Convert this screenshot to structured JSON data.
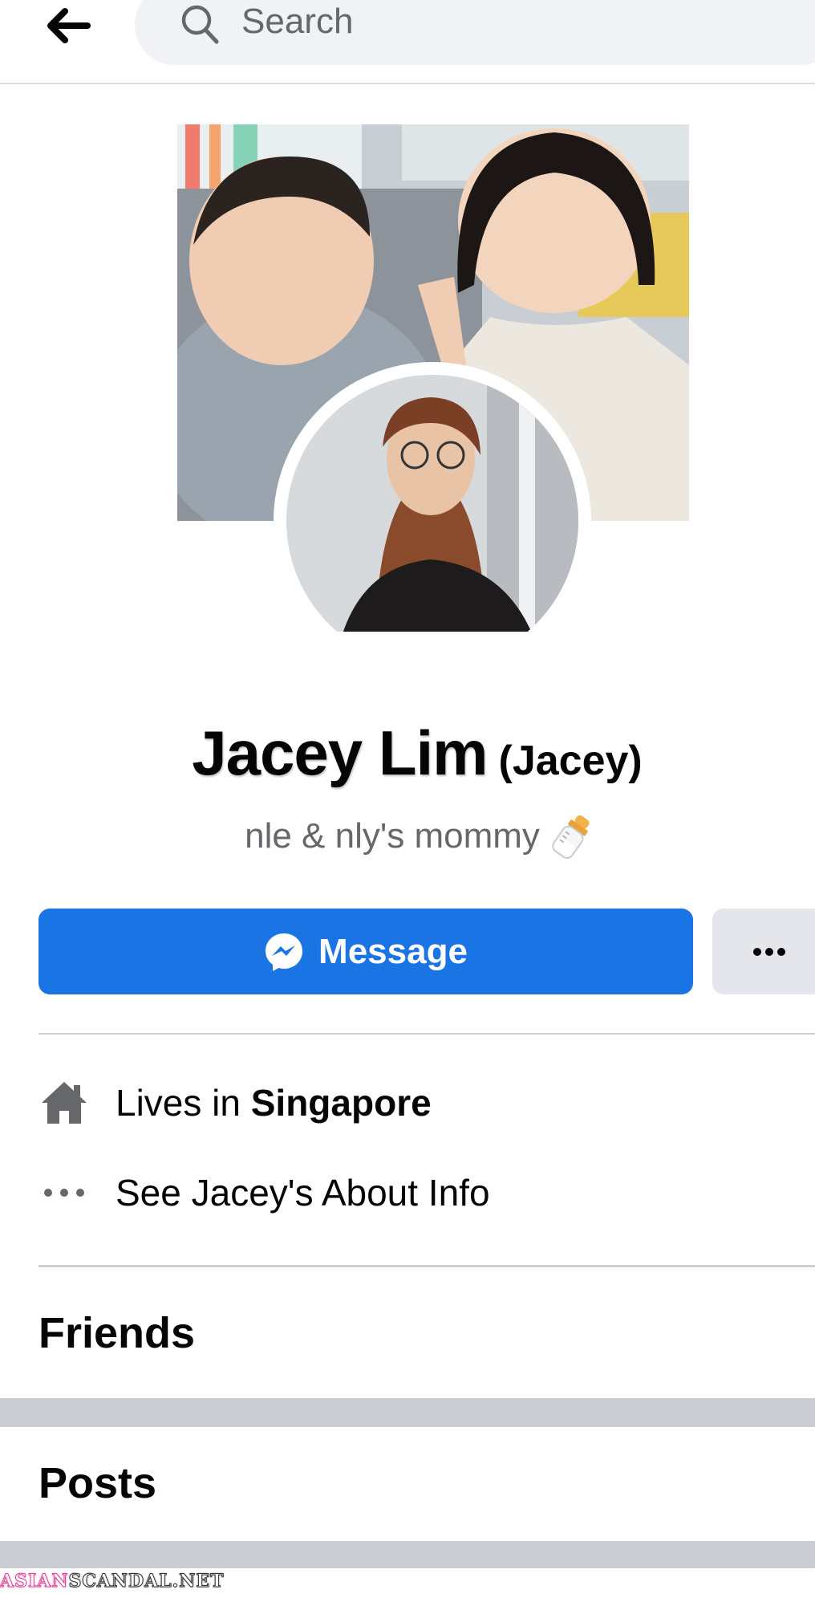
{
  "header": {
    "back_icon": "arrow-left-icon",
    "search_icon": "search-icon",
    "search_placeholder": "Search"
  },
  "profile": {
    "cover_photo": "cover-photo",
    "avatar": "profile-picture",
    "name": "Jacey Lim",
    "nickname": "(Jacey)",
    "bio": "nle & nly's mommy",
    "bio_emoji": "baby-bottle-icon"
  },
  "actions": {
    "message_label": "Message",
    "message_icon": "messenger-icon",
    "more_icon": "more-dots-icon"
  },
  "intro": {
    "lives_prefix": "Lives in ",
    "lives_city": "Singapore",
    "about_link": "See Jacey's About Info"
  },
  "sections": {
    "friends_title": "Friends",
    "posts_title": "Posts"
  },
  "watermark": {
    "part1": "ASIAN",
    "part2": "SCANDAL.NET"
  },
  "colors": {
    "accent": "#1b74e4",
    "secondary_text": "#65676b",
    "band": "#c9ccd1"
  }
}
